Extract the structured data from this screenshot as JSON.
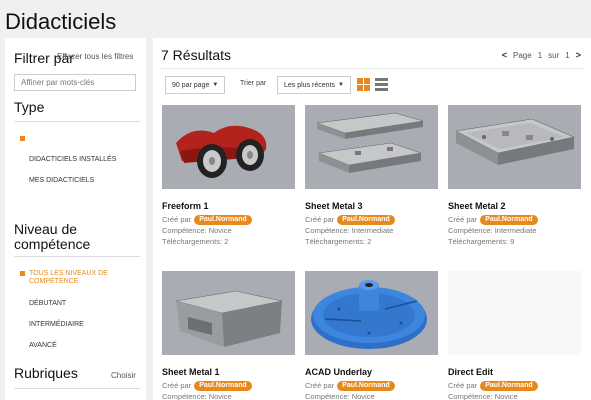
{
  "page": {
    "title": "Didacticiels"
  },
  "sidebar": {
    "filter_title": "Filtrer par",
    "clear_label": "Effacer tous les filtres",
    "search_placeholder": "Affiner par mots-clés",
    "type_heading": "Type",
    "type_items": [
      "DIDACTICIELS INSTALLÉS",
      "MES DIDACTICIELS"
    ],
    "level_heading": "Niveau de compétence",
    "level_items": [
      "TOUS LES NIVEAUX DE COMPÉTENCE",
      "DÉBUTANT",
      "INTERMÉDIAIRE",
      "AVANCÉ"
    ],
    "topics_heading": "Rubriques",
    "topics_choose": "Choisir"
  },
  "results": {
    "title": "7 Résultats",
    "pager": {
      "prev": "<",
      "page_label": "Page",
      "page": "1",
      "of": "sur",
      "total": "1",
      "next": ">"
    },
    "per_page": "90 par page",
    "sort_label": "Trier par",
    "sort_value": "Les plus récents"
  },
  "labels": {
    "created_by": "Créé par",
    "competence": "Compétence:",
    "downloads": "Téléchargements:"
  },
  "cards": [
    {
      "title": "Freeform 1",
      "author": "Paul.Normand",
      "competence": "Novice",
      "downloads": "2"
    },
    {
      "title": "Sheet Metal 3",
      "author": "Paul.Normand",
      "competence": "Intermediate",
      "downloads": "2"
    },
    {
      "title": "Sheet Metal 2",
      "author": "Paul.Normand",
      "competence": "Intermediate",
      "downloads": "9"
    },
    {
      "title": "Sheet Metal 1",
      "author": "Paul.Normand",
      "competence": "Novice",
      "downloads": ""
    },
    {
      "title": "ACAD Underlay",
      "author": "Paul.Normand",
      "competence": "Novice",
      "downloads": ""
    },
    {
      "title": "Direct Edit",
      "author": "Paul.Normand",
      "competence": "Novice",
      "downloads": ""
    }
  ],
  "colors": {
    "accent": "#e8891d",
    "panel": "#ffffff",
    "background": "#f0f0f0",
    "thumb_bg": "#a9adb3"
  }
}
